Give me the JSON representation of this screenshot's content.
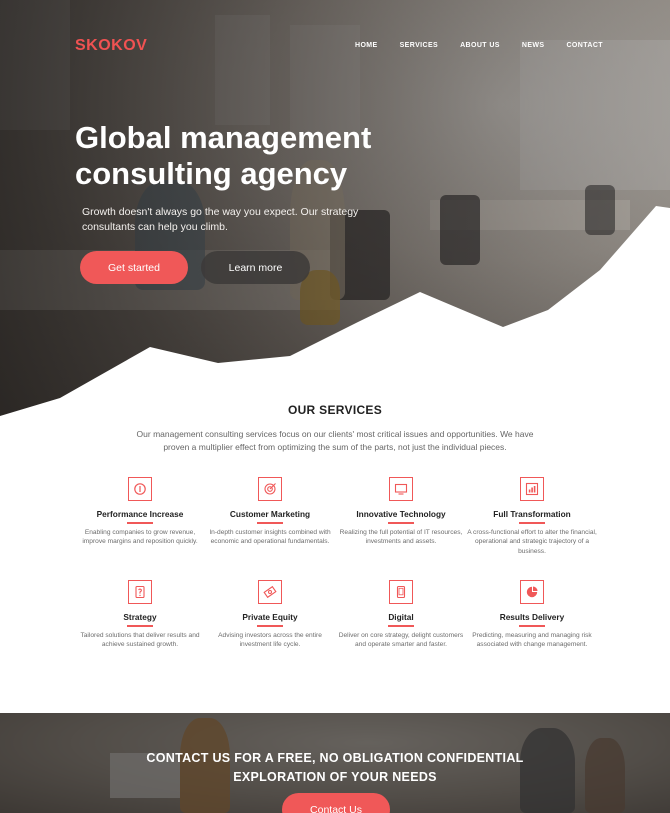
{
  "brand": {
    "logo": "SKOKOV",
    "accent": "#f05858"
  },
  "nav": {
    "items": [
      "HOME",
      "SERVICES",
      "ABOUT US",
      "NEWS",
      "CONTACT"
    ]
  },
  "hero": {
    "title": "Global management consulting agency",
    "subtitle": "Growth doesn't always go the way you expect. Our strategy consultants can help you climb.",
    "primary_button": "Get started",
    "secondary_button": "Learn more"
  },
  "services": {
    "title": "OUR SERVICES",
    "intro": "Our management consulting services focus on our clients' most critical issues and opportunities. We have proven a multiplier effect from optimizing the sum of the parts, not just the individual pieces.",
    "items": [
      {
        "icon": "performance-icon",
        "title": "Performance Increase",
        "desc": "Enabling companies to grow revenue, improve margins and reposition quickly."
      },
      {
        "icon": "target-icon",
        "title": "Customer Marketing",
        "desc": "In-depth customer insights combined with economic and operational fundamentals."
      },
      {
        "icon": "monitor-icon",
        "title": "Innovative Technology",
        "desc": "Realizing the full potential of IT resources, investments and assets."
      },
      {
        "icon": "chart-icon",
        "title": "Full Transformation",
        "desc": "A cross-functional effort to alter the financial, operational and strategic trajectory of a business."
      },
      {
        "icon": "strategy-icon",
        "title": "Strategy",
        "desc": "Tailored solutions that deliver results and achieve sustained growth."
      },
      {
        "icon": "money-icon",
        "title": "Private Equity",
        "desc": "Advising investors across the entire investment life cycle."
      },
      {
        "icon": "tablet-icon",
        "title": "Digital",
        "desc": "Deliver on core strategy, delight customers and operate smarter and faster."
      },
      {
        "icon": "pie-icon",
        "title": "Results Delivery",
        "desc": "Predicting, measuring and managing risk associated with change management."
      }
    ]
  },
  "contact": {
    "line1": "CONTACT US FOR A FREE, NO OBLIGATION CONFIDENTIAL",
    "line2": "EXPLORATION OF YOUR NEEDS",
    "button": "Contact Us"
  }
}
